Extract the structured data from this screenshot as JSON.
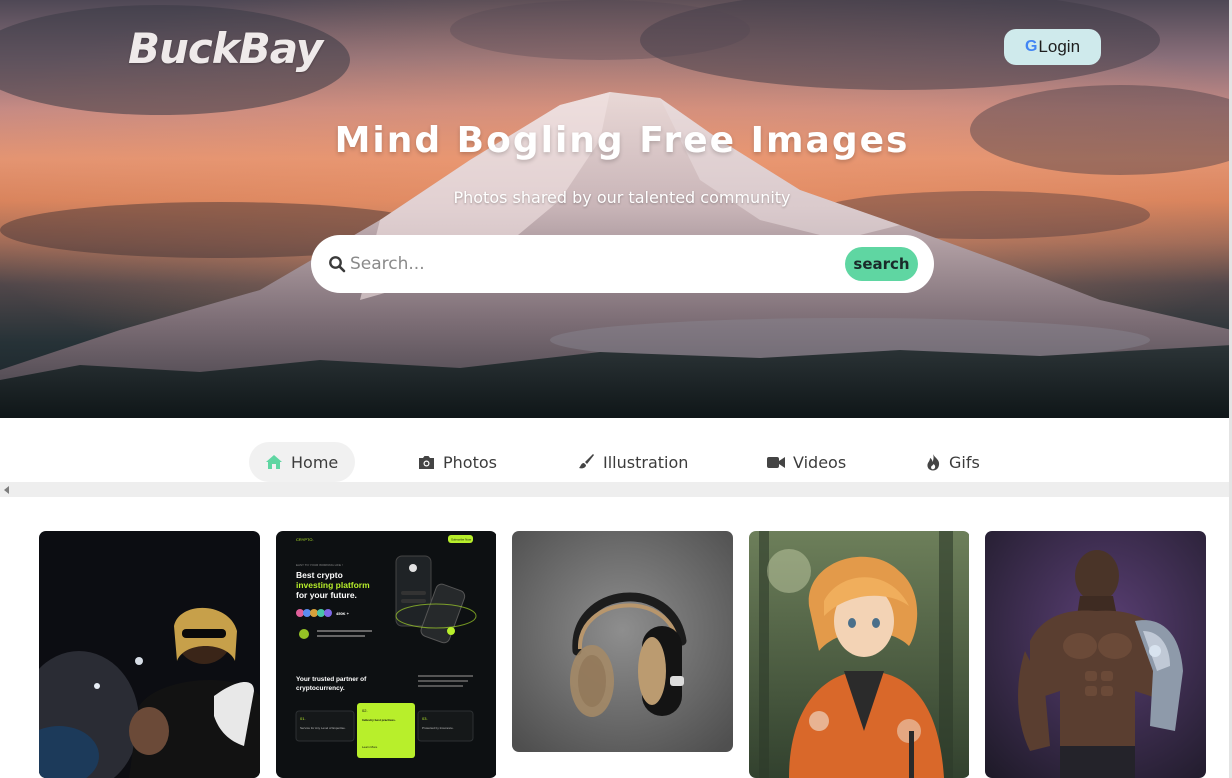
{
  "header": {
    "logo_text": "BuckBay",
    "login_label": "Login",
    "login_icon": "google-g-icon"
  },
  "hero": {
    "title": "Mind Bogling Free Images",
    "subtitle": "Photos shared by our talented community",
    "search_placeholder": "Search...",
    "search_button_label": "search",
    "search_icon": "magnifier-icon"
  },
  "nav": {
    "items": [
      {
        "label": "Home",
        "icon": "home-icon",
        "active": true
      },
      {
        "label": "Photos",
        "icon": "camera-icon",
        "active": false
      },
      {
        "label": "Illustration",
        "icon": "paintbrush-icon",
        "active": false
      },
      {
        "label": "Videos",
        "icon": "video-camera-icon",
        "active": false
      },
      {
        "label": "Gifs",
        "icon": "fire-icon",
        "active": false
      }
    ]
  },
  "crypto_card": {
    "brand": "CRYPTO.",
    "cta": "Subscribe Now",
    "eyebrow": "EASY TO YOUR WORKING LIFE !",
    "headline_line1": "Best crypto",
    "headline_line2": "investing platform",
    "headline_line3": "for your future.",
    "stat": "450K +",
    "section_title_line1": "Your trusted partner of",
    "section_title_line2": "cryptocurrency.",
    "box1_num": "01.",
    "box1_text": "Service for Any Level of Expertise.",
    "box2_num": "02.",
    "box2_text": "Industry best practices.",
    "box2_link": "Learn More",
    "box3_num": "03.",
    "box3_text": "Protected by Insurance."
  },
  "colors": {
    "accent_green": "#5fd6a2",
    "login_bg": "#cfeaec",
    "nav_active_bg": "#f1f1f1"
  }
}
